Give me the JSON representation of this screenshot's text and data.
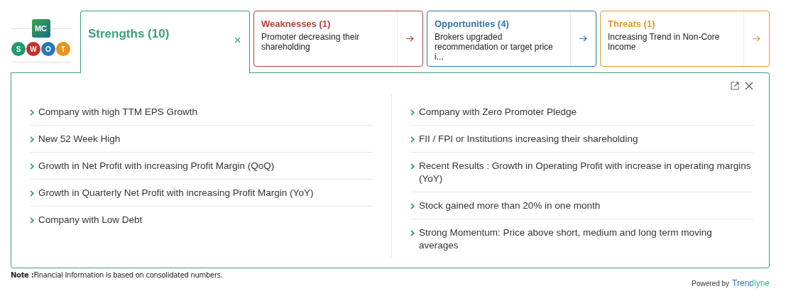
{
  "logo": {
    "badge": "MC",
    "letters": [
      {
        "text": "S",
        "color": "#1e9a6e"
      },
      {
        "text": "W",
        "color": "#c2312b"
      },
      {
        "text": "O",
        "color": "#2a77b8"
      },
      {
        "text": "T",
        "color": "#e8941a"
      }
    ]
  },
  "tabs": [
    {
      "label": "Strengths (10)",
      "selected": true,
      "color": "#3a9e7c"
    },
    {
      "label": "Weaknesses (1)",
      "text": "Promoter decreasing their shareholding",
      "selected": false,
      "color": "#b8403a"
    },
    {
      "label": "Opportunities (4)",
      "text": "Brokers upgraded recommendation or target price i...",
      "selected": false,
      "color": "#2f76a8"
    },
    {
      "label": "Threats (1)",
      "text": "Increasing Trend in Non-Core Income",
      "selected": false,
      "color": "#e09a2a"
    }
  ],
  "panel": {
    "columns": [
      [
        "Company with high TTM EPS Growth",
        "New 52 Week High",
        "Growth in Net Profit with increasing Profit Margin (QoQ)",
        "Growth in Quarterly Net Profit with increasing Profit Margin (YoY)",
        "Company with Low Debt"
      ],
      [
        "Company with Zero Promoter Pledge",
        "FII / FPI or Institutions increasing their shareholding",
        "Recent Results : Growth in Operating Profit with increase in operating margins (YoY)",
        "Stock gained more than 20% in one month",
        "Strong Momentum: Price above short, medium and long term moving averages"
      ]
    ]
  },
  "footer": {
    "note": "**Note :**Financial Information is based on consolidated numbers.",
    "powered_by": "Powered by",
    "brand": "Trendlyne"
  }
}
